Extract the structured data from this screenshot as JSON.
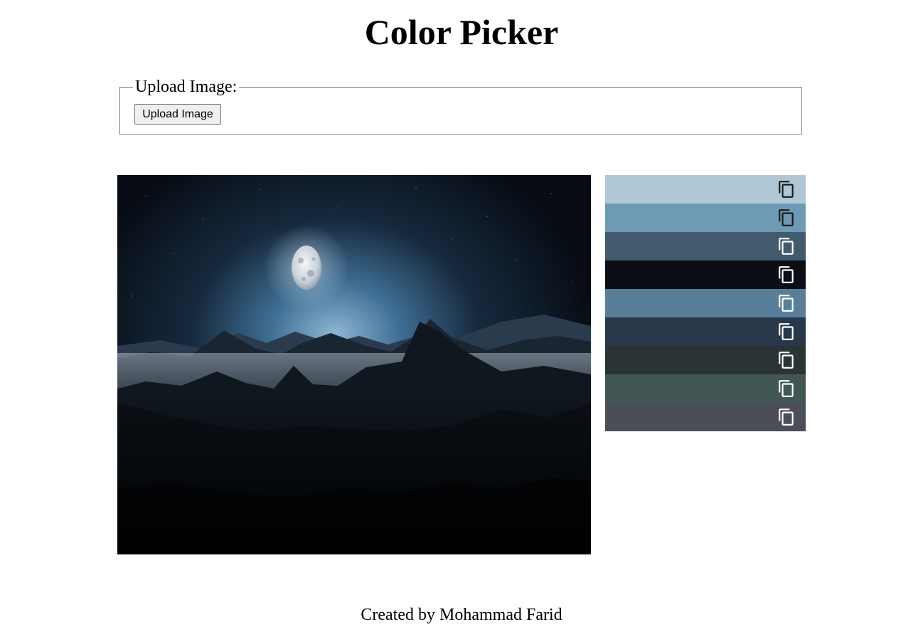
{
  "page": {
    "title": "Color Picker",
    "footer": "Created by Mohammad Farid"
  },
  "upload": {
    "legend": "Upload Image:",
    "button_label": "Upload Image"
  },
  "image": {
    "subject": "moonlit mountain night scene"
  },
  "palette": {
    "copy_icon": "copy-icon",
    "swatches": [
      {
        "color": "#b0c7d6",
        "icon_color": "#1a1a1a"
      },
      {
        "color": "#6e9ab3",
        "icon_color": "#1a1a1a"
      },
      {
        "color": "#425a6e",
        "icon_color": "#ffffff"
      },
      {
        "color": "#0b0e14",
        "icon_color": "#ffffff"
      },
      {
        "color": "#587e9a",
        "icon_color": "#ffffff"
      },
      {
        "color": "#28384a",
        "icon_color": "#ffffff"
      },
      {
        "color": "#2a3335",
        "icon_color": "#ffffff"
      },
      {
        "color": "#435656",
        "icon_color": "#ffffff"
      },
      {
        "color": "#4b4e56",
        "icon_color": "#ffffff"
      }
    ]
  }
}
